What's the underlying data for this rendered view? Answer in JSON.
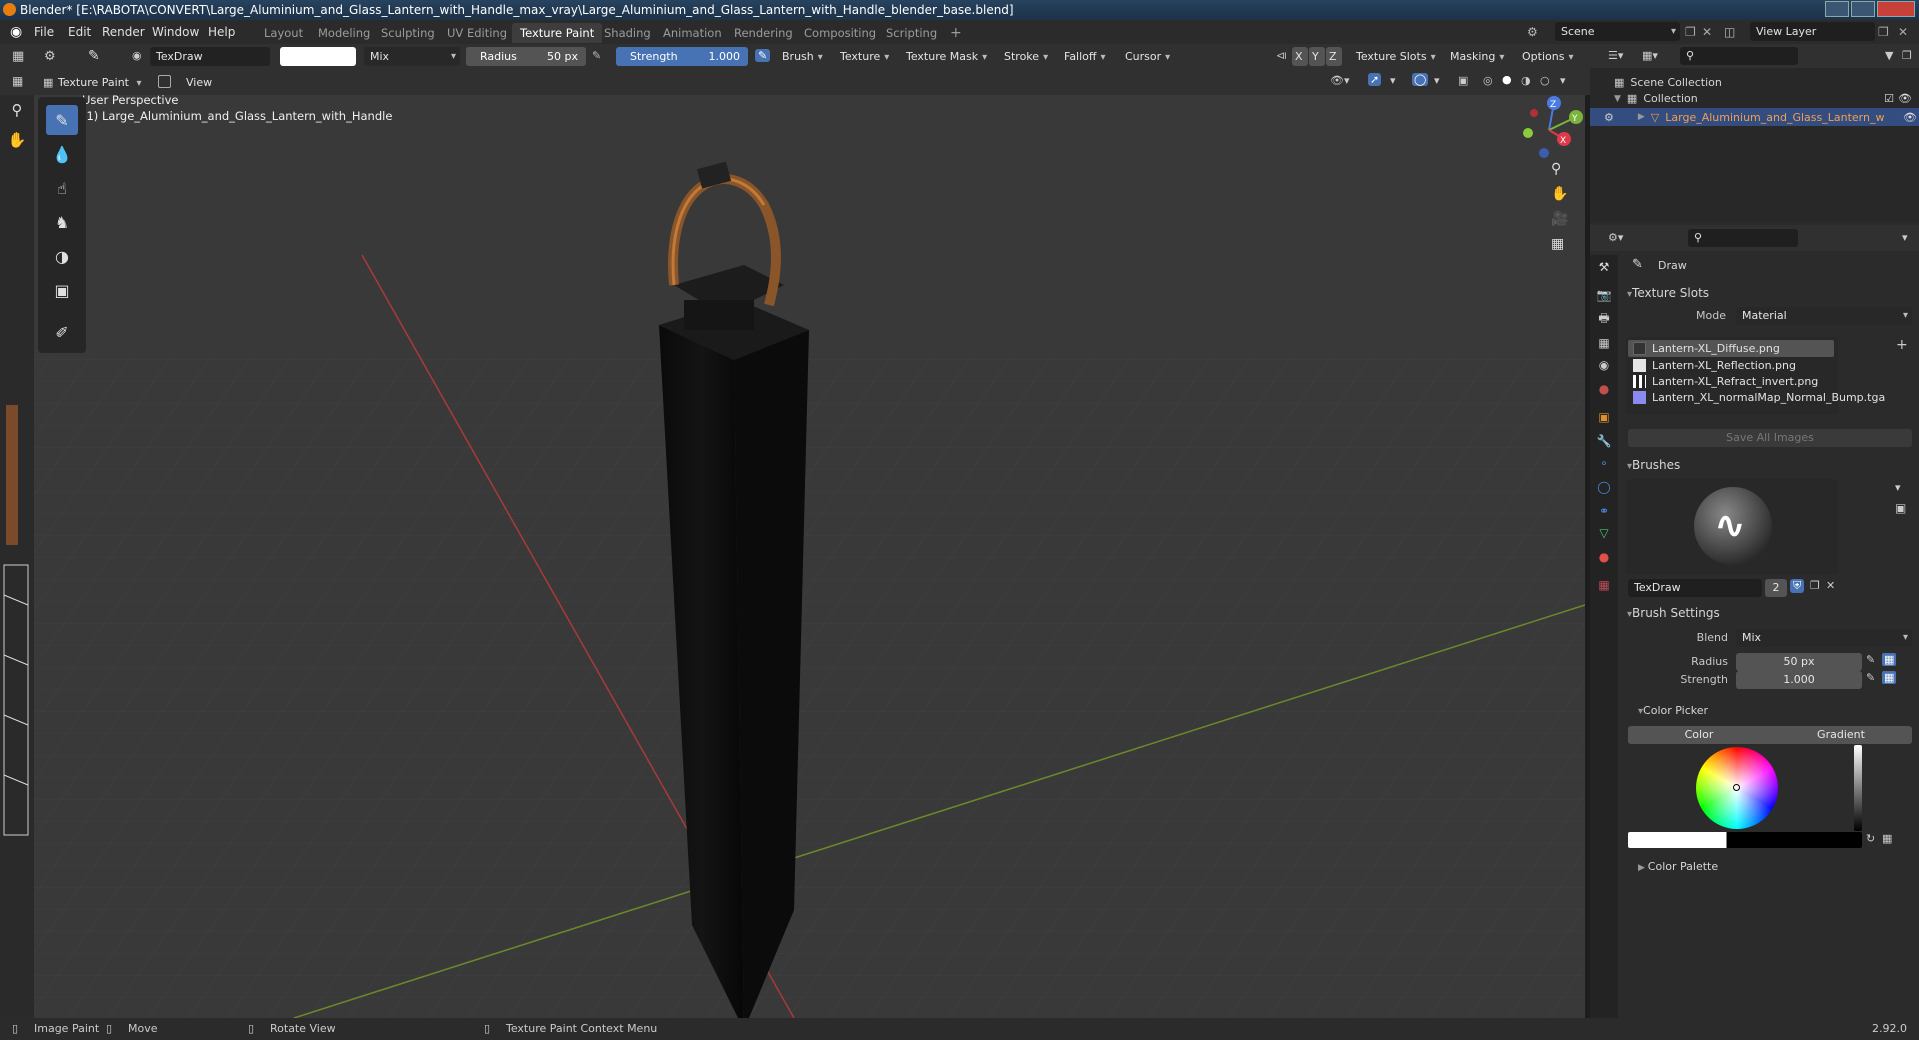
{
  "title_bar": {
    "text": "Blender* [E:\\RABOTA\\CONVERT\\Large_Aluminium_and_Glass_Lantern_with_Handle_max_vray\\Large_Aluminium_and_Glass_Lantern_with_Handle_blender_base.blend]"
  },
  "menu": [
    "File",
    "Edit",
    "Render",
    "Window",
    "Help"
  ],
  "workspaces": [
    "Layout",
    "Modeling",
    "Sculpting",
    "UV Editing",
    "Texture Paint",
    "Shading",
    "Animation",
    "Rendering",
    "Compositing",
    "Scripting"
  ],
  "active_workspace": "Texture Paint",
  "scene": {
    "name": "Scene",
    "view_layer": "View Layer"
  },
  "tool_header": {
    "brush_name": "TexDraw",
    "blend": "Mix",
    "radius_label": "Radius",
    "radius_value": "50 px",
    "strength_label": "Strength",
    "strength_value": "1.000",
    "menus": [
      "Brush",
      "Texture",
      "Texture Mask",
      "Stroke",
      "Falloff",
      "Cursor"
    ],
    "axes": [
      "X",
      "Y",
      "Z"
    ],
    "right_menus": [
      "Texture Slots",
      "Masking",
      "Options"
    ]
  },
  "view_header": {
    "mode": "Texture Paint",
    "view": "View"
  },
  "viewport": {
    "perspective": "User Perspective",
    "object_label": "(1) Large_Aluminium_and_Glass_Lantern_with_Handle",
    "gizmo": {
      "x": "X",
      "y": "Y",
      "z": "Z"
    }
  },
  "outliner": {
    "scene_collection": "Scene Collection",
    "collection": "Collection",
    "object": "Large_Aluminium_and_Glass_Lantern_w"
  },
  "properties": {
    "tool_name": "Draw",
    "texture_slots": {
      "header": "Texture Slots",
      "mode_label": "Mode",
      "mode_value": "Material",
      "slots": [
        "Lantern-XL_Diffuse.png",
        "Lantern-XL_Reflection.png",
        "Lantern-XL_Refract_invert.png",
        "Lantern_XL_normalMap_Normal_Bump.tga"
      ],
      "save_all": "Save All Images"
    },
    "brushes": {
      "header": "Brushes",
      "brush_name": "TexDraw",
      "users": "2"
    },
    "brush_settings": {
      "header": "Brush Settings",
      "blend_label": "Blend",
      "blend_value": "Mix",
      "radius_label": "Radius",
      "radius_value": "50 px",
      "strength_label": "Strength",
      "strength_value": "1.000"
    },
    "color_picker": {
      "header": "Color Picker",
      "tab_color": "Color",
      "tab_gradient": "Gradient"
    },
    "color_palette": {
      "header": "Color Palette"
    }
  },
  "status_bar": {
    "image_paint": "Image Paint",
    "move": "Move",
    "rotate_view": "Rotate View",
    "context_menu": "Texture Paint Context Menu",
    "version": "2.92.0"
  },
  "colors": {
    "accent": "#4772b3",
    "header_bg": "#303030",
    "viewport_bg": "#393939",
    "brush_color": "#ffffff"
  }
}
